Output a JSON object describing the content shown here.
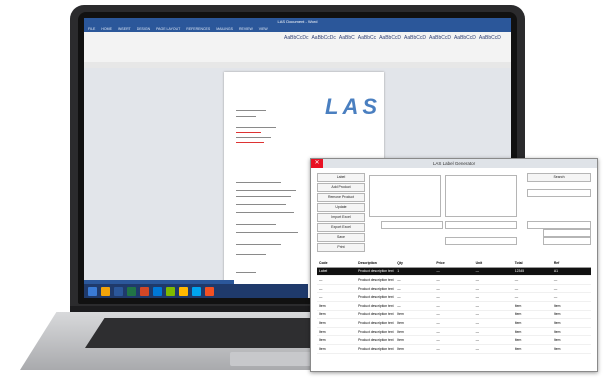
{
  "word": {
    "title": "LAS Document - Word",
    "tabs": [
      "FILE",
      "HOME",
      "INSERT",
      "DESIGN",
      "PAGE LAYOUT",
      "REFERENCES",
      "MAILINGS",
      "REVIEW",
      "VIEW"
    ],
    "styles": [
      "AaBbCcDc",
      "AaBbCcDc",
      "AaBbC",
      "AaBbCc",
      "AaBbCcD",
      "AaBbCcD",
      "AaBbCcD",
      "AaBbCcD",
      "AaBbCcD"
    ],
    "logo_letters": [
      "L",
      "A",
      "S"
    ]
  },
  "dialog": {
    "title": "LAS Label Generator",
    "close": "✕",
    "left_buttons": [
      "Label",
      "Add Product",
      "Remove Product",
      "Update",
      "Import Excel",
      "Export Excel",
      "Save",
      "Print"
    ],
    "right_button": "Search",
    "columns": [
      "Code",
      "Description",
      "Qty",
      "Price",
      "Unit",
      "Total",
      "Ref"
    ],
    "rows": [
      [
        "Label",
        "Product description text",
        "1",
        "—",
        "—",
        "12345",
        "A1"
      ],
      [
        "—",
        "Product description text",
        "—",
        "—",
        "—",
        "—",
        "—"
      ],
      [
        "—",
        "Product description text",
        "—",
        "—",
        "—",
        "—",
        "—"
      ],
      [
        "—",
        "Product description text",
        "—",
        "—",
        "—",
        "—",
        "—"
      ],
      [
        "Item",
        "Product description text",
        "—",
        "—",
        "—",
        "Item",
        "Item"
      ],
      [
        "Item",
        "Product description text",
        "Item",
        "—",
        "—",
        "Item",
        "Item"
      ],
      [
        "Item",
        "Product description text",
        "Item",
        "—",
        "—",
        "Item",
        "Item"
      ],
      [
        "Item",
        "Product description text",
        "Item",
        "—",
        "—",
        "Item",
        "Item"
      ],
      [
        "Item",
        "Product description text",
        "Item",
        "—",
        "—",
        "Item",
        "Item"
      ],
      [
        "Item",
        "Product description text",
        "Item",
        "—",
        "—",
        "Item",
        "Item"
      ]
    ],
    "selected_row": 0
  },
  "colors": {
    "word_blue": "#2b579a",
    "logo_blue": "#4a7fc0",
    "close_red": "#e81123"
  }
}
